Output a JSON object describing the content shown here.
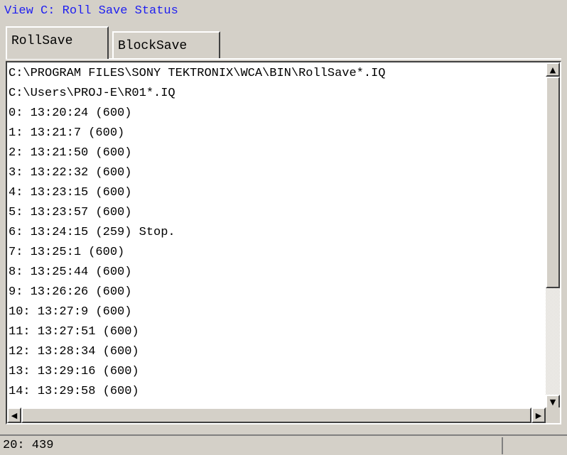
{
  "window": {
    "title": "View C: Roll Save Status"
  },
  "tabs": [
    {
      "label": "RollSave",
      "active": true
    },
    {
      "label": "BlockSave",
      "active": false
    }
  ],
  "log": {
    "lines": [
      "C:\\PROGRAM FILES\\SONY TEKTRONIX\\WCA\\BIN\\RollSave*.IQ",
      "C:\\Users\\PROJ-E\\R01*.IQ",
      "0: 13:20:24 (600)",
      "1: 13:21:7 (600)",
      "2: 13:21:50 (600)",
      "3: 13:22:32 (600)",
      "4: 13:23:15 (600)",
      "5: 13:23:57 (600)",
      "6: 13:24:15 (259) Stop.",
      "7: 13:25:1 (600)",
      "8: 13:25:44 (600)",
      "9: 13:26:26 (600)",
      "10: 13:27:9 (600)",
      "11: 13:27:51 (600)",
      "12: 13:28:34 (600)",
      "13: 13:29:16 (600)",
      "14: 13:29:58 (600)"
    ]
  },
  "scrollbar_icons": {
    "up": "scroll-up-arrow-icon",
    "down": "scroll-down-arrow-icon",
    "left": "scroll-left-arrow-icon",
    "right": "scroll-right-arrow-icon"
  },
  "statusbar": {
    "text": "20: 439"
  },
  "colors": {
    "title": "#1f1ff0",
    "face": "#d4d0c8"
  }
}
